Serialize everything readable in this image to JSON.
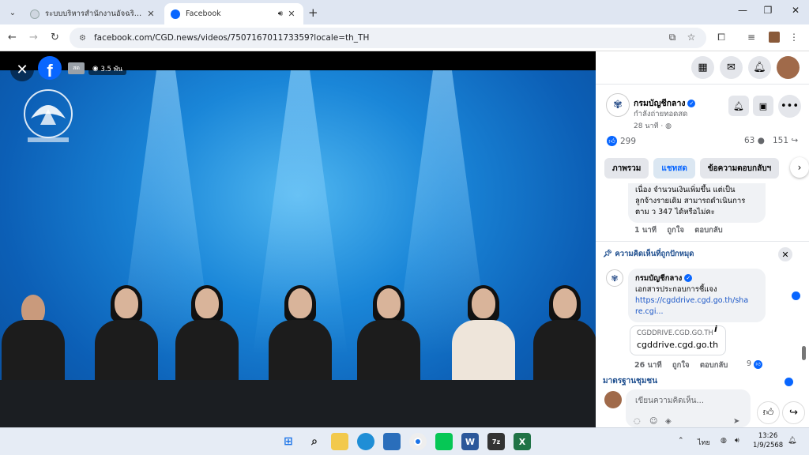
{
  "browser": {
    "tabs": [
      {
        "title": "ระบบบริหารสำนักงานอัจฉริยะ | เข้าสู่",
        "active": false
      },
      {
        "title": "Facebook",
        "active": true
      }
    ],
    "url": "facebook.com/CGD.news/videos/750716701173359?locale=th_TH"
  },
  "video": {
    "live_badge": "สด",
    "views": "3.5 พัน"
  },
  "post": {
    "page_name": "กรมบัญชีกลาง",
    "status": "กำลังถ่ายทอดสด",
    "time": "28 นาที ·",
    "likes": "299",
    "comments_count": "63",
    "shares_count": "151"
  },
  "tabs": [
    "ภาพรวม",
    "แชทสด",
    "ข้อความตอบกลับฯ"
  ],
  "comments": [
    {
      "text_lines": [
        "เนื่อง จำนวนเงินเพิ่มขึ้น แต่เป็น",
        "ลูกจ้างรายเดิม สามารถดำเนินการ",
        "ตาม ว 347 ได้หรือไม่คะ"
      ],
      "time": "1 นาที",
      "like_label": "ถูกใจ",
      "reply_label": "ตอบกลับ"
    }
  ],
  "pinned": {
    "header": "ความคิดเห็นที่ถูกปักหมุด",
    "author": "กรมบัญชีกลาง",
    "text": "เอกสารประกอบการชี้แจง",
    "link_line1": "https://cgddrive.cgd.go.th/sha",
    "link_line2": "re.cgi...",
    "card_domain": "CGDDRIVE.CGD.GO.TH",
    "card_host": "cgddrive.cgd.go.th",
    "time": "26 นาที",
    "like_label": "ถูกใจ",
    "reply_label": "ตอบกลับ",
    "likes": "9"
  },
  "composer": {
    "section_label": "มาตรฐานชุมชน",
    "placeholder": "เขียนความคิดเห็น..."
  },
  "taskbar": {
    "lang": "ไทย",
    "time": "13:26",
    "date": "1/9/2568"
  },
  "colors": {
    "fb_blue": "#0866ff",
    "chrome_tabstrip": "#dfe6f2"
  }
}
